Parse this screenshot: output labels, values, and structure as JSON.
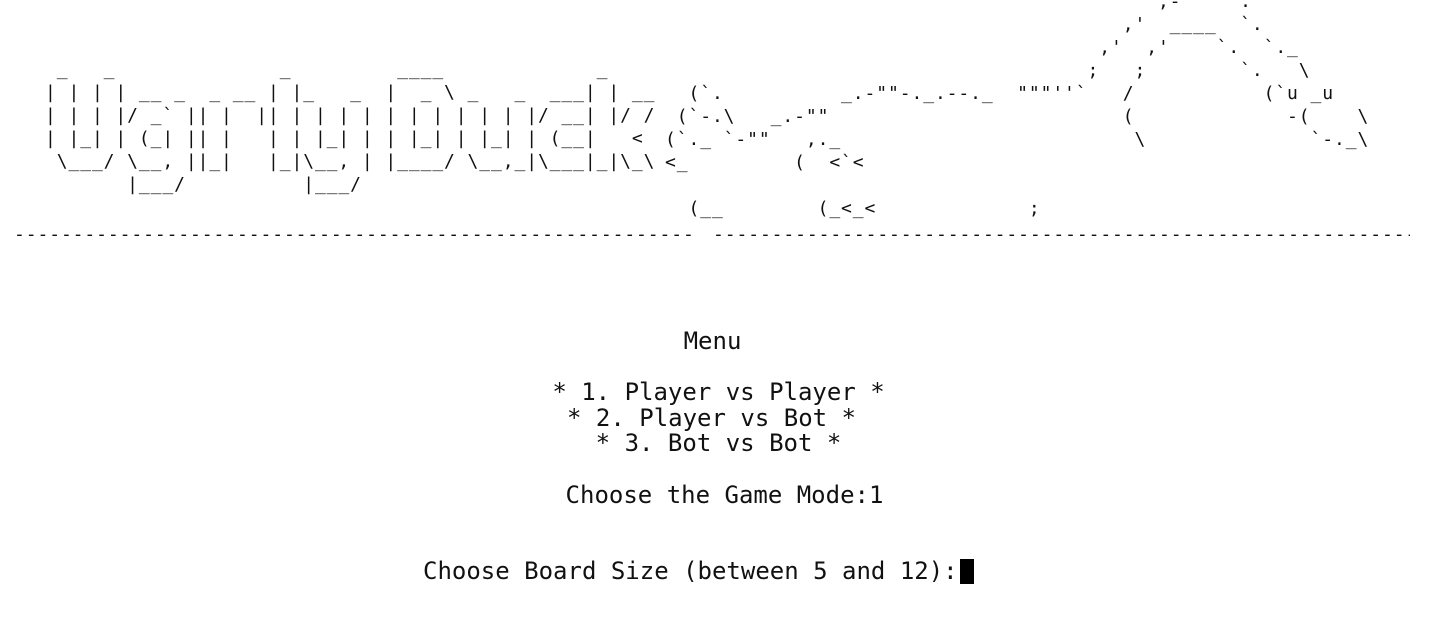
{
  "banner": {
    "title_art": " _   _              _         ____             _    \n| | | | __ _  _ __ | |_   _  |  _ \\ _   _  ___| | __\n| | | |/ _` || |  || | | | | | | | | | | |/ __| |/ /\n| |_| | (_| || |   | | |_| | | |_| | |_| | (__|   < \n \\___/ \\__, ||_|   |_|\\__, | |____/ \\__,_|\\___|_|\\_\\\n       |___/          |___/                           ",
    "duck_art": "                                          ,-\"\" \"\".\n                                       ,'  ____  `.\n                                     ,'  ,'    `.  `._\n                                    ;   ;        `.   \\\n  (`.          _.-\"\"-._.--._  \"\"\"''`   /           (`u _u\n (`-.\\   _.-\"\"                         (             -(    \\\n(`._ `-\"\"   ,._                         \\              `-._\\\n<_         (  <`<\n\n  (__        (_<_<             ;"
  },
  "divider": "--------------------------------------------------------------------------------------------------------------------------------------------------------------------------",
  "menu": {
    "title": "Menu",
    "options": [
      "* 1. Player vs Player *",
      "* 2. Player vs Bot *",
      "* 3. Bot vs Bot *"
    ]
  },
  "prompts": {
    "game_mode": "Choose the Game Mode:1",
    "board_size": "Choose Board Size (between 5 and 12):"
  },
  "input": {
    "board_size_value": ""
  }
}
